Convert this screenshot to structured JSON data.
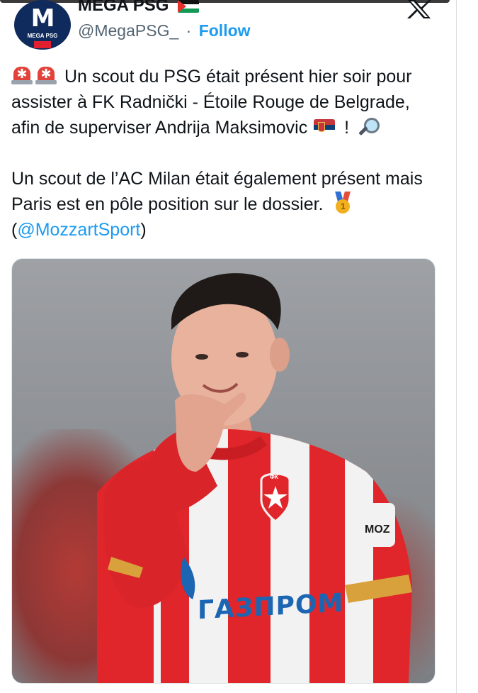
{
  "account": {
    "display_name": "MEGA PSG",
    "name_emoji": "palestine-flag",
    "handle": "@MegaPSG_",
    "separator": "·",
    "follow_label": "Follow",
    "avatar_text": "M",
    "avatar_brand": "MEGA PSG"
  },
  "tweet": {
    "line1": "Un scout du PSG était présent hier soir pour assister à FK Radnički - Étoile Rouge de Belgrade, afin de superviser Andrija Maksimovic",
    "line1_end": " !",
    "para2": "Un scout de l’AC Milan était également présent mais Paris est en pôle position sur le dossier.",
    "mention_open": "(",
    "mention": "@MozzartSport",
    "mention_close": ")",
    "medal_digit": "1"
  },
  "photo": {
    "sponsor_text": "ГАЗПРОМ",
    "sleeve_badge": "MOZ",
    "crest_text": "ФК"
  },
  "icons": [
    "x-logo-icon",
    "siren-icon",
    "serbia-flag-icon",
    "magnifier-icon",
    "medal-icon"
  ],
  "colors": {
    "link": "#1d9bf0",
    "text": "#0f1419",
    "secondary": "#536471",
    "jersey_red": "#e0262b"
  }
}
